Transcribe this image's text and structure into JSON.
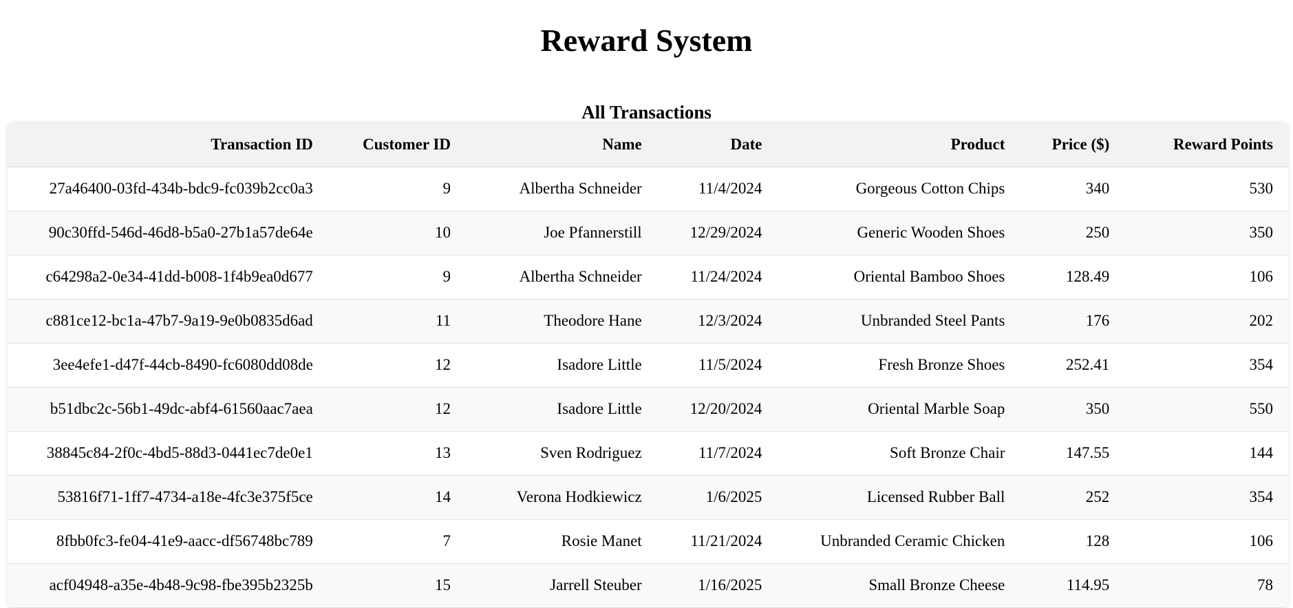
{
  "page": {
    "title": "Reward System",
    "subtitle": "All Transactions"
  },
  "table": {
    "columns": [
      "Transaction ID",
      "Customer ID",
      "Name",
      "Date",
      "Product",
      "Price ($)",
      "Reward Points"
    ],
    "rows": [
      [
        "27a46400-03fd-434b-bdc9-fc039b2cc0a3",
        "9",
        "Albertha Schneider",
        "11/4/2024",
        "Gorgeous Cotton Chips",
        "340",
        "530"
      ],
      [
        "90c30ffd-546d-46d8-b5a0-27b1a57de64e",
        "10",
        "Joe Pfannerstill",
        "12/29/2024",
        "Generic Wooden Shoes",
        "250",
        "350"
      ],
      [
        "c64298a2-0e34-41dd-b008-1f4b9ea0d677",
        "9",
        "Albertha Schneider",
        "11/24/2024",
        "Oriental Bamboo Shoes",
        "128.49",
        "106"
      ],
      [
        "c881ce12-bc1a-47b7-9a19-9e0b0835d6ad",
        "11",
        "Theodore Hane",
        "12/3/2024",
        "Unbranded Steel Pants",
        "176",
        "202"
      ],
      [
        "3ee4efe1-d47f-44cb-8490-fc6080dd08de",
        "12",
        "Isadore Little",
        "11/5/2024",
        "Fresh Bronze Shoes",
        "252.41",
        "354"
      ],
      [
        "b51dbc2c-56b1-49dc-abf4-61560aac7aea",
        "12",
        "Isadore Little",
        "12/20/2024",
        "Oriental Marble Soap",
        "350",
        "550"
      ],
      [
        "38845c84-2f0c-4bd5-88d3-0441ec7de0e1",
        "13",
        "Sven Rodriguez",
        "11/7/2024",
        "Soft Bronze Chair",
        "147.55",
        "144"
      ],
      [
        "53816f71-1ff7-4734-a18e-4fc3e375f5ce",
        "14",
        "Verona Hodkiewicz",
        "1/6/2025",
        "Licensed Rubber Ball",
        "252",
        "354"
      ],
      [
        "8fbb0fc3-fe04-41e9-aacc-df56748bc789",
        "7",
        "Rosie Manet",
        "11/21/2024",
        "Unbranded Ceramic Chicken",
        "128",
        "106"
      ],
      [
        "acf04948-a35e-4b48-9c98-fbe395b2325b",
        "15",
        "Jarrell Steuber",
        "1/16/2025",
        "Small Bronze Cheese",
        "114.95",
        "78"
      ]
    ]
  }
}
